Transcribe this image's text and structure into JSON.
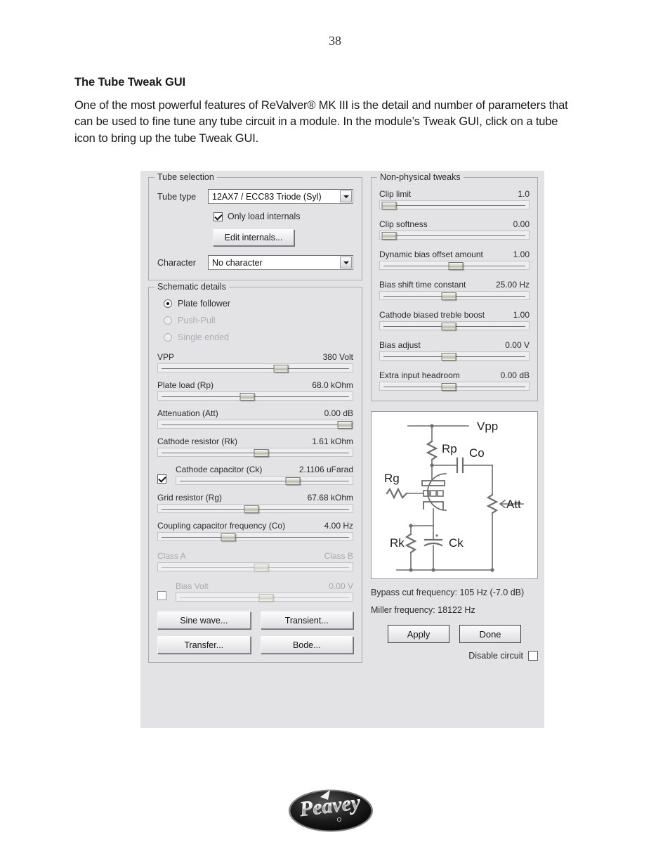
{
  "document": {
    "page_number": "38",
    "heading": "The Tube Tweak GUI",
    "paragraph": "One of the most powerful features of ReValver® MK III is the detail and number of parameters that can be used to fine tune any tube circuit in a module. In the module’s Tweak GUI, click on a tube icon to bring up the tube Tweak GUI."
  },
  "dialog": {
    "tube_selection": {
      "title": "Tube selection",
      "tube_type_label": "Tube type",
      "tube_type_value": "12AX7 / ECC83 Triode (Syl)",
      "only_load_internals_label": "Only load internals",
      "only_load_internals_checked": true,
      "edit_internals_label": "Edit internals...",
      "character_label": "Character",
      "character_value": "No character"
    },
    "schematic_details": {
      "title": "Schematic details",
      "radios": [
        {
          "label": "Plate follower",
          "selected": true,
          "enabled": true
        },
        {
          "label": "Push-Pull",
          "selected": false,
          "enabled": false
        },
        {
          "label": "Single ended",
          "selected": false,
          "enabled": false
        }
      ],
      "sliders": [
        {
          "label": "VPP",
          "value": "380 Volt",
          "pos": 63,
          "enabled": true
        },
        {
          "label": "Plate load (Rp)",
          "value": "68.0 kOhm",
          "pos": 46,
          "enabled": true
        },
        {
          "label": "Attenuation (Att)",
          "value": "0.00 dB",
          "pos": 96,
          "enabled": true
        },
        {
          "label": "Cathode resistor (Rk)",
          "value": "1.61 kOhm",
          "pos": 53,
          "enabled": true
        },
        {
          "label": "Grid resistor (Rg)",
          "value": "67.68 kOhm",
          "pos": 48,
          "enabled": true
        },
        {
          "label": "Coupling capacitor frequency (Co)",
          "value": "4.00 Hz",
          "pos": 36,
          "enabled": true
        }
      ],
      "cathode_capacitor": {
        "label": "Cathode capacitor (Ck)",
        "value": "2.1106 uFarad",
        "pos": 66,
        "checked": true,
        "enabled": true
      },
      "class_slider": {
        "label_left": "Class A",
        "label_right": "Class B",
        "pos": 53,
        "enabled": false
      },
      "bias_volt": {
        "label": "Bias Volt",
        "value": "0.00 V",
        "pos": 51,
        "checked": false,
        "enabled": false
      },
      "buttons": [
        "Sine wave...",
        "Transient...",
        "Transfer...",
        "Bode..."
      ]
    },
    "non_physical_tweaks": {
      "title": "Non-physical tweaks",
      "sliders": [
        {
          "label": "Clip limit",
          "value": "1.0",
          "pos": 6
        },
        {
          "label": "Clip softness",
          "value": "0.00",
          "pos": 6
        },
        {
          "label": "Dynamic bias offset amount",
          "value": "1.00",
          "pos": 51
        },
        {
          "label": "Bias shift time constant",
          "value": "25.00 Hz",
          "pos": 46
        },
        {
          "label": "Cathode biased treble boost",
          "value": "1.00",
          "pos": 46
        },
        {
          "label": "Bias adjust",
          "value": "0.00 V",
          "pos": 46
        },
        {
          "label": "Extra input headroom",
          "value": "0.00 dB",
          "pos": 46
        }
      ]
    },
    "schematic_diagram": {
      "labels": {
        "vpp": "Vpp",
        "rp": "Rp",
        "co": "Co",
        "rg": "Rg",
        "att": "Att",
        "rk": "Rk",
        "ck": "Ck"
      }
    },
    "info": {
      "bypass_cut_frequency": "Bypass cut frequency: 105 Hz (-7.0 dB)",
      "miller_frequency": "Miller frequency: 18122 Hz"
    },
    "actions": {
      "apply_label": "Apply",
      "done_label": "Done",
      "disable_circuit_label": "Disable circuit",
      "disable_circuit_checked": false
    }
  },
  "footer": {
    "logo_alt": "Peavey"
  }
}
